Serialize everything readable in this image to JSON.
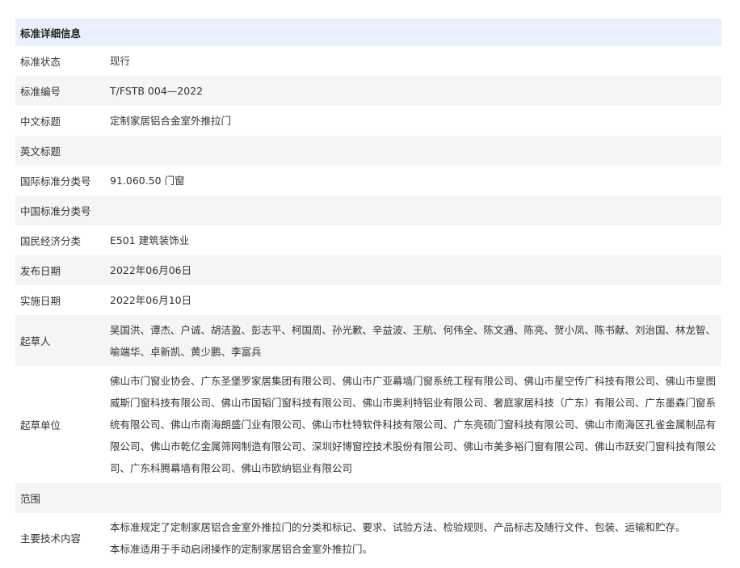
{
  "header": {
    "title": "标准详细信息"
  },
  "rows": [
    {
      "label": "标准状态",
      "value": "现行"
    },
    {
      "label": "标准编号",
      "value": "T/FSTB 004—2022"
    },
    {
      "label": "中文标题",
      "value": "定制家居铝合金室外推拉门"
    },
    {
      "label": "英文标题",
      "value": ""
    },
    {
      "label": "国际标准分类号",
      "value": "91.060.50 门窗"
    },
    {
      "label": "中国标准分类号",
      "value": ""
    },
    {
      "label": "国民经济分类",
      "value": "E501 建筑装饰业"
    },
    {
      "label": "发布日期",
      "value": "2022年06月06日"
    },
    {
      "label": "实施日期",
      "value": "2022年06月10日"
    },
    {
      "label": "起草人",
      "value": "吴国洪、谭杰、户诚、胡洁盈、彭志平、柯国周、孙光歉、辛益波、王航、何伟全、陈文通、陈亮、贺小凤、陈书献、刘治国、林龙智、喻端华、卓新凯、黄少鹏、李富兵"
    },
    {
      "label": "起草单位",
      "value": "佛山市门窗业协会、广东圣堡罗家居集团有限公司、佛山市广亚幕墙门窗系统工程有限公司、佛山市星空传广科技有限公司、佛山市皇图威斯门窗科技有限公司、佛山市国韬门窗科技有限公司、佛山市奥利特铝业有限公司、奢庭家居科技（广东）有限公司、广东墨森门窗系统有限公司、佛山市南海朗盛门业有限公司、佛山市杜特软件科技有限公司、广东亮硕门窗科技有限公司、佛山市南海区孔雀金属制品有限公司、佛山市乾亿金属筛网制造有限公司、深圳好博窗控技术股份有限公司、佛山市美多裕门窗有限公司、佛山市跃安门窗科技有限公司、广东科腾幕墙有限公司、佛山市欧纳铝业有限公司"
    },
    {
      "label": "范围",
      "value": ""
    },
    {
      "label": "主要技术内容",
      "value": "本标准规定了定制家居铝合金室外推拉门的分类和标记、要求、试验方法、检验规则、产品标志及随行文件、包装、运输和贮存。",
      "value2": "本标准适用于手动启闭操作的定制家居铝合金室外推拉门。"
    }
  ]
}
